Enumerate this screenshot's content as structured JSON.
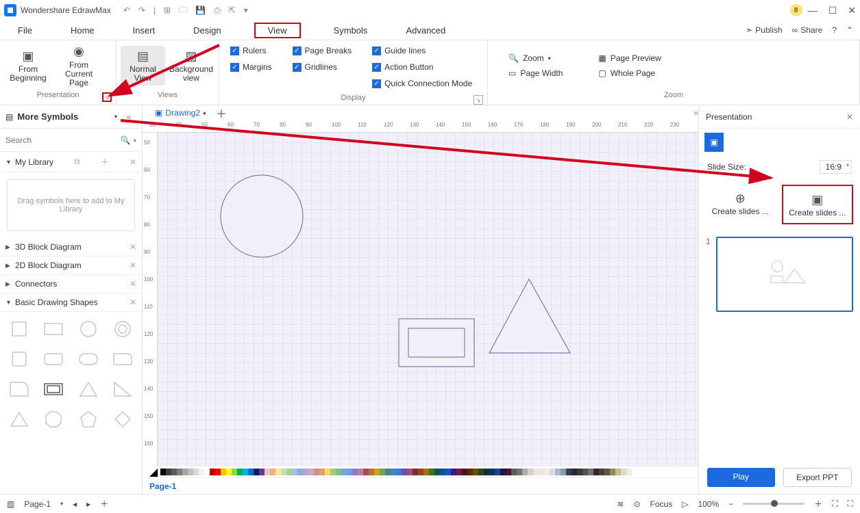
{
  "app": {
    "name": "Wondershare EdrawMax",
    "badge": "8"
  },
  "menubar": {
    "items": [
      "File",
      "Home",
      "Insert",
      "Design",
      "View",
      "Symbols",
      "Advanced"
    ],
    "active": "View",
    "publish": "Publish",
    "share": "Share"
  },
  "ribbon": {
    "presentation": {
      "label": "Presentation",
      "from_beginning": "From\nBeginning",
      "from_current": "From Current\nPage"
    },
    "views": {
      "label": "Views",
      "normal": "Normal\nView",
      "background": "Background\nview"
    },
    "display": {
      "label": "Display",
      "rulers": "Rulers",
      "page_breaks": "Page Breaks",
      "guide_lines": "Guide lines",
      "margins": "Margins",
      "gridlines": "Gridlines",
      "action_button": "Action Button",
      "quick_connection": "Quick Connection Mode"
    },
    "zoom": {
      "label": "Zoom",
      "zoom": "Zoom",
      "page_preview": "Page Preview",
      "page_width": "Page Width",
      "whole_page": "Whole Page"
    }
  },
  "symbols_panel": {
    "title": "More Symbols",
    "search_placeholder": "Search",
    "my_library": "My Library",
    "drag_hint": "Drag symbols here to add to My Library",
    "sections": [
      "3D Block Diagram",
      "2D Block Diagram",
      "Connectors",
      "Basic Drawing Shapes"
    ]
  },
  "canvas": {
    "tab_name": "Drawing2",
    "page_tab": "Page-1",
    "status_page": "Page-1"
  },
  "ruler_h": [
    30,
    40,
    50,
    60,
    70,
    80,
    90,
    100,
    110,
    120,
    130,
    140,
    150,
    160,
    170,
    180,
    190,
    200,
    210,
    220,
    230
  ],
  "ruler_v": [
    50,
    60,
    70,
    80,
    90,
    100,
    110,
    120,
    130,
    140,
    150,
    160
  ],
  "presentation_panel": {
    "title": "Presentation",
    "slide_size_label": "Slide Size:",
    "slide_size_value": "16:9",
    "create_manual": "Create slides ...",
    "create_auto": "Create slides ...",
    "slide_number": "1",
    "play": "Play",
    "export": "Export PPT"
  },
  "statusbar": {
    "page": "Page-1",
    "focus": "Focus",
    "zoom": "100%"
  },
  "colors": [
    "#000000",
    "#3f3f3f",
    "#595959",
    "#7f7f7f",
    "#a5a5a5",
    "#bfbfbf",
    "#d8d8d8",
    "#f2f2f2",
    "#ffffff",
    "#c00000",
    "#ff0000",
    "#ffc000",
    "#ffff00",
    "#92d050",
    "#00b050",
    "#00b0f0",
    "#0070c0",
    "#002060",
    "#7030a0",
    "#e7c5c5",
    "#f4b084",
    "#ffe699",
    "#c6e0b4",
    "#a9d08e",
    "#9bc2e6",
    "#8ea9db",
    "#b4a7d6",
    "#d5a6bd",
    "#d08e8e",
    "#e2a06b",
    "#f8d568",
    "#a4c97c",
    "#7fbf7f",
    "#6fa8dc",
    "#6d9eeb",
    "#8e7cc3",
    "#c27ba0",
    "#a64d4d",
    "#bf6d3f",
    "#d4a017",
    "#6aa84f",
    "#45818e",
    "#3d85c6",
    "#3c78d8",
    "#674ea7",
    "#a64d79",
    "#7b2e2e",
    "#8c4a1f",
    "#9c7300",
    "#38761d",
    "#134f5c",
    "#0b5394",
    "#1155cc",
    "#351c75",
    "#741b47",
    "#4c1414",
    "#5b2c06",
    "#6b4f00",
    "#274e13",
    "#0c343d",
    "#073763",
    "#1c4587",
    "#20124d",
    "#4c1130",
    "#5b5b5b",
    "#767171",
    "#afabab",
    "#d0cece",
    "#e7e6e6",
    "#fbe5d6",
    "#ededed",
    "#d6dce5",
    "#adb9ca",
    "#8497b0",
    "#333f50",
    "#222a35",
    "#3b3838",
    "#525252",
    "#757171",
    "#312a29",
    "#4a4038",
    "#615547",
    "#938953",
    "#c4bd97",
    "#ddd9c3",
    "#eeece1"
  ]
}
